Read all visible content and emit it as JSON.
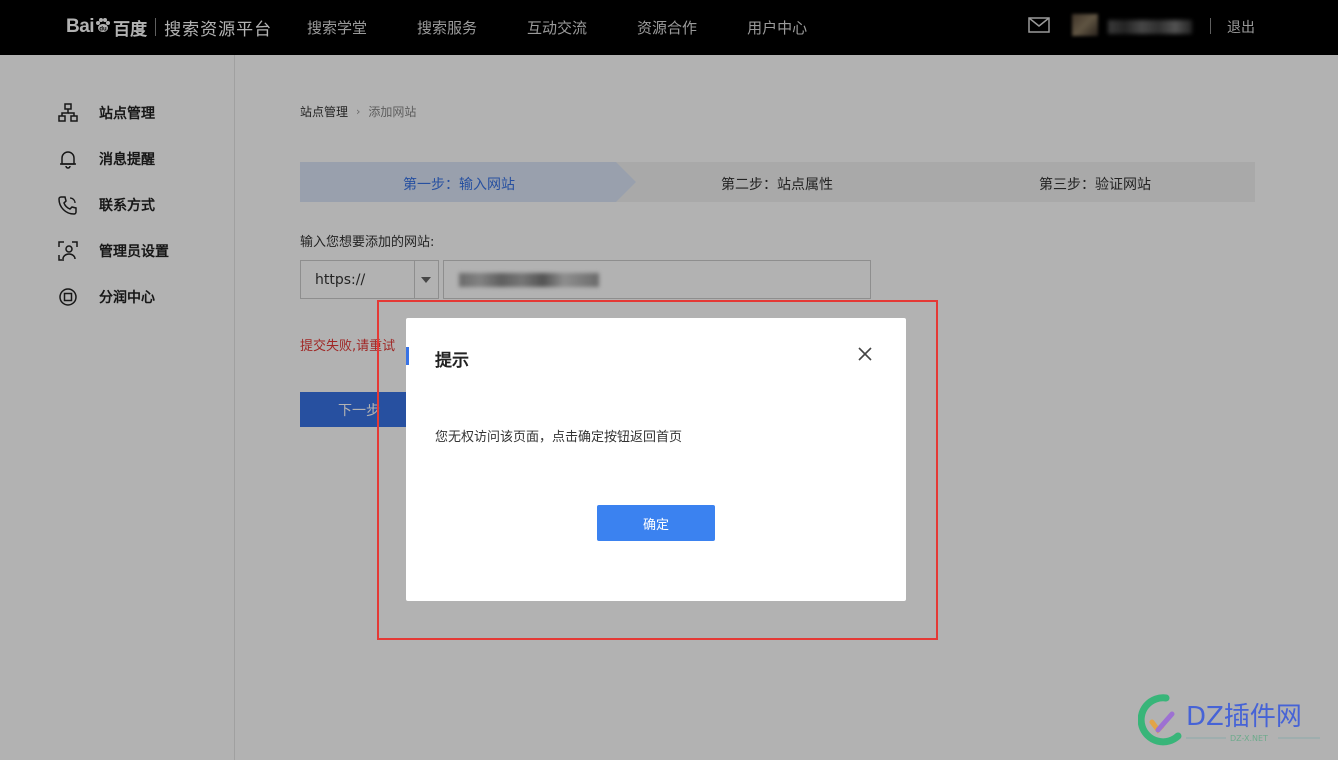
{
  "header": {
    "logo_text": "Bai",
    "logo_cn": "百度",
    "platform": "搜索资源平台",
    "nav": [
      "搜索学堂",
      "搜索服务",
      "互动交流",
      "资源合作",
      "用户中心"
    ],
    "logout": "退出"
  },
  "sidebar": {
    "items": [
      {
        "label": "站点管理",
        "icon": "sitemap-icon"
      },
      {
        "label": "消息提醒",
        "icon": "bell-icon"
      },
      {
        "label": "联系方式",
        "icon": "phone-icon"
      },
      {
        "label": "管理员设置",
        "icon": "admin-icon"
      },
      {
        "label": "分润中心",
        "icon": "revenue-icon"
      }
    ]
  },
  "breadcrumb": {
    "parent": "站点管理",
    "separator": "›",
    "current": "添加网站"
  },
  "steps": [
    {
      "label": "第一步：输入网站",
      "active": true
    },
    {
      "label": "第二步：站点属性",
      "active": false
    },
    {
      "label": "第三步：验证网站",
      "active": false
    }
  ],
  "form": {
    "label": "输入您想要添加的网站:",
    "protocol": "https://",
    "error": "提交失败,请重试",
    "next": "下一步"
  },
  "dialog": {
    "title": "提示",
    "message": "您无权访问该页面，点击确定按钮返回首页",
    "ok": "确定"
  },
  "watermark": {
    "brand": "DZ插件网",
    "sub": "DZ-X.NET"
  },
  "colors": {
    "accent": "#3873e6",
    "error": "#e53935",
    "highlight": "#e53935"
  }
}
